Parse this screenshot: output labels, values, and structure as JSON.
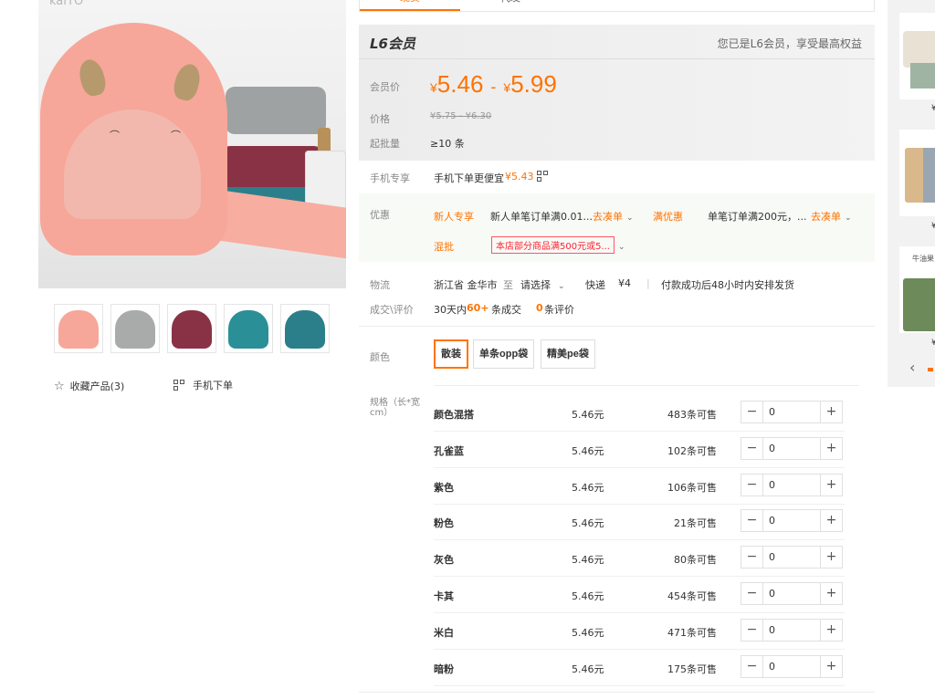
{
  "gallery": {
    "brand_text": "kaITO",
    "thumbnails": [
      {
        "name": "thumb-pink-hood",
        "color": "#f6a79a"
      },
      {
        "name": "thumb-grey-towel",
        "color": "#a9abab"
      },
      {
        "name": "thumb-maroon-towel",
        "color": "#8a3245"
      },
      {
        "name": "thumb-red-teal-hoods",
        "color": "#2b8f98"
      },
      {
        "name": "thumb-teal-hood",
        "color": "#2b7f8a"
      }
    ],
    "favorite_label": "收藏产品(3)",
    "mobile_order_label": "手机下单"
  },
  "tabs": [
    "现货",
    "代发"
  ],
  "price_box": {
    "vip_title": "L6会员",
    "vip_note": "您已是L6会员，享受最高权益",
    "member_price_label": "会员价",
    "currency": "¥",
    "price_low": "5.46",
    "price_high": "5.99",
    "price_sep": "-",
    "list_price_label": "价格",
    "list_price": "¥5.75 - ¥6.30",
    "min_buy_label": "起批量",
    "min_buy": "≥10 条"
  },
  "mobile_exclusive": {
    "label": "手机专享",
    "text": "手机下单更便宜",
    "price": "¥5.43"
  },
  "promotions": {
    "label": "优惠",
    "new_user_tag": "新人专享",
    "new_user_text": "新人单笔订单满0.01...",
    "go_collect_1": "去凑单",
    "full_discount_tag": "满优惠",
    "full_discount_text": "单笔订单满200元，...",
    "go_collect_2": "去凑单",
    "mixed_tag": "混批",
    "mixed_text": "本店部分商品满500元或5..."
  },
  "logistics": {
    "label": "物流",
    "origin": "浙江省 金华市",
    "to": "至",
    "destination": "请选择",
    "method": "快递",
    "fee": "¥4",
    "ship_note": "付款成功后48小时内安排发货"
  },
  "deals": {
    "label": "成交\\评价",
    "prefix": "30天内",
    "count": "60+",
    "suffix": "条成交",
    "reviews_count": "0",
    "reviews_suffix": "条评价"
  },
  "color_options": {
    "label": "颜色",
    "options": [
      "散装",
      "单条opp袋",
      "精美pe袋"
    ],
    "selected_index": 0
  },
  "spec_label": "规格（长*宽cm）",
  "skus": [
    {
      "name": "颜色混搭",
      "price": "5.46元",
      "stock": "483条可售",
      "qty": "0"
    },
    {
      "name": "孔雀蓝",
      "price": "5.46元",
      "stock": "102条可售",
      "qty": "0"
    },
    {
      "name": "紫色",
      "price": "5.46元",
      "stock": "106条可售",
      "qty": "0"
    },
    {
      "name": "粉色",
      "price": "5.46元",
      "stock": "21条可售",
      "qty": "0"
    },
    {
      "name": "灰色",
      "price": "5.46元",
      "stock": "80条可售",
      "qty": "0"
    },
    {
      "name": "卡其",
      "price": "5.46元",
      "stock": "454条可售",
      "qty": "0"
    },
    {
      "name": "米白",
      "price": "5.46元",
      "stock": "471条可售",
      "qty": "0"
    },
    {
      "name": "暗粉",
      "price": "5.46元",
      "stock": "175条可售",
      "qty": "0"
    }
  ],
  "right_panel": {
    "top_text": "¥",
    "prices": [
      "¥",
      "¥",
      "¥"
    ],
    "item3_text": "牛油果"
  },
  "colors": {
    "accent": "#ff7300",
    "promo_red": "#ff2233"
  }
}
